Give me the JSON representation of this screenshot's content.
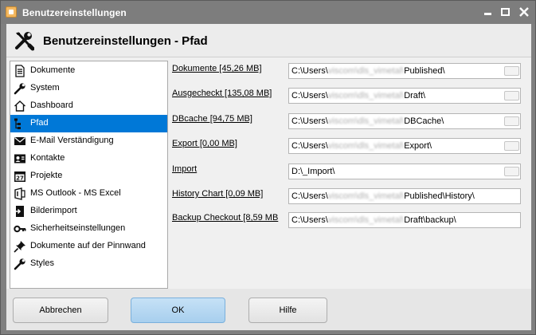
{
  "window": {
    "title": "Benutzereinstellungen"
  },
  "header": {
    "title": "Benutzereinstellungen - Pfad",
    "icon": "tools-icon"
  },
  "nav": {
    "items": [
      {
        "label": "Dokumente",
        "icon": "document-icon",
        "selected": false
      },
      {
        "label": "System",
        "icon": "wrench-icon",
        "selected": false
      },
      {
        "label": "Dashboard",
        "icon": "home-icon",
        "selected": false
      },
      {
        "label": "Pfad",
        "icon": "path-icon",
        "selected": true
      },
      {
        "label": "E-Mail Verständigung",
        "icon": "email-icon",
        "selected": false
      },
      {
        "label": "Kontakte",
        "icon": "contact-card-icon",
        "selected": false
      },
      {
        "label": "Projekte",
        "icon": "calendar-icon",
        "selected": false
      },
      {
        "label": "MS Outlook - MS Excel",
        "icon": "office-icon",
        "selected": false
      },
      {
        "label": "Bilderimport",
        "icon": "image-import-icon",
        "selected": false
      },
      {
        "label": "Sicherheitseinstellungen",
        "icon": "key-icon",
        "selected": false
      },
      {
        "label": "Dokumente auf der Pinnwand",
        "icon": "pin-icon",
        "selected": false
      },
      {
        "label": "Styles",
        "icon": "wrench-icon",
        "selected": false
      }
    ]
  },
  "paths": [
    {
      "label": "Dokumente [45,26 MB]",
      "prefix": "C:\\Users\\",
      "hidden": "viscom\\dls_vimetal\\",
      "suffix": "Published\\",
      "browse": true
    },
    {
      "label": "Ausgecheckt [135,08 MB]",
      "prefix": "C:\\Users\\",
      "hidden": "viscom\\dls_vimetal\\",
      "suffix": "Draft\\",
      "browse": true
    },
    {
      "label": "DBcache [94,75 MB]",
      "prefix": "C:\\Users\\",
      "hidden": "viscom\\dls_vimetal\\",
      "suffix": "DBCache\\",
      "browse": true
    },
    {
      "label": "Export [0,00 MB]",
      "prefix": "C:\\Users\\",
      "hidden": "viscom\\dls_vimetal\\",
      "suffix": "Export\\",
      "browse": true
    },
    {
      "label": "Import",
      "prefix": "D:\\_Import\\",
      "hidden": "",
      "suffix": "",
      "browse": true
    },
    {
      "label": "History Chart [0,09 MB]",
      "prefix": "C:\\Users\\",
      "hidden": "viscom\\dls_vimetal\\",
      "suffix": "Published\\History\\",
      "browse": false
    },
    {
      "label": "Backup Checkout [8,59 MB",
      "prefix": "C:\\Users\\",
      "hidden": "viscom\\dls_vimetal\\",
      "suffix": "Draft\\backup\\",
      "browse": false
    }
  ],
  "footer": {
    "cancel_label": "Abbrechen",
    "ok_label": "OK",
    "help_label": "Hilfe"
  },
  "colors": {
    "selection": "#0078d7",
    "ok_button": "#b8d9f2",
    "titlebar": "#7d7d7d"
  }
}
